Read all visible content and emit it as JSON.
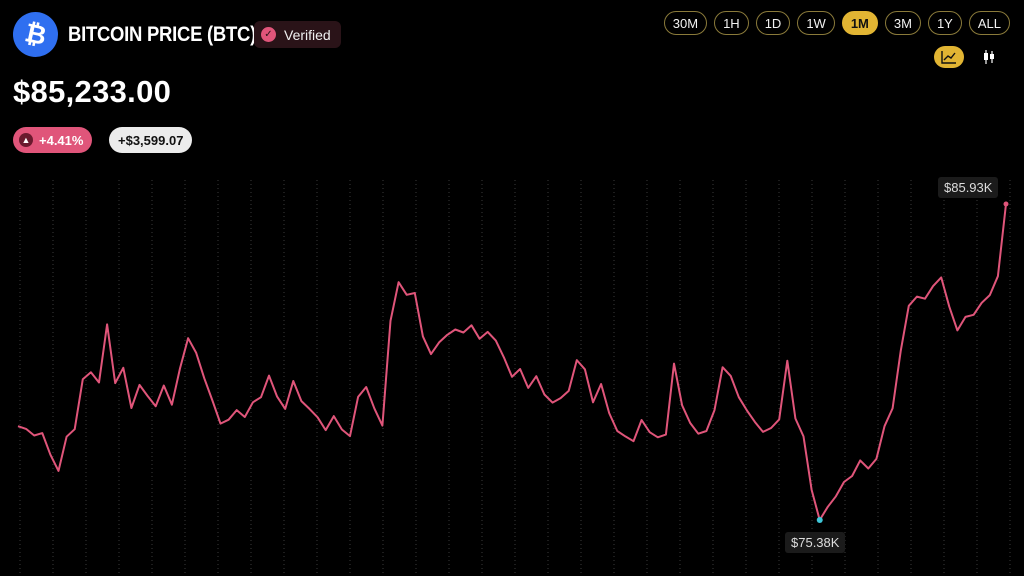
{
  "header": {
    "title": "BITCOIN PRICE (BTC)",
    "verified_label": "Verified",
    "logo_icon": "bitcoin-icon",
    "logo_color": "#2f6ff0"
  },
  "price": {
    "current": "$85,233.00",
    "change_pct": "+4.41%",
    "change_abs": "+$3,599.07",
    "change_color": "#e0557a"
  },
  "ranges": {
    "options": [
      "30M",
      "1H",
      "1D",
      "1W",
      "1M",
      "3M",
      "1Y",
      "ALL"
    ],
    "active": "1M",
    "accent": "#e2b533"
  },
  "view": {
    "options": [
      "line-chart-icon",
      "candlestick-icon"
    ],
    "active": "line-chart-icon"
  },
  "chart_data": {
    "type": "line",
    "title": "",
    "xlabel": "",
    "ylabel": "",
    "grid": "vertical-dotted",
    "line_color": "#e0557a",
    "max_label": "$85.93K",
    "min_label": "$75.38K",
    "ylim": [
      75380,
      85930
    ],
    "series": [
      {
        "values": [
          78510,
          78420,
          78200,
          78280,
          77560,
          77020,
          78160,
          78410,
          80080,
          80310,
          79970,
          81910,
          79950,
          80460,
          79120,
          79890,
          79520,
          79180,
          79870,
          79230,
          80440,
          81450,
          80960,
          80110,
          79370,
          78600,
          78730,
          79050,
          78820,
          79310,
          79480,
          80200,
          79500,
          79090,
          80020,
          79350,
          79090,
          78810,
          78380,
          78850,
          78400,
          78180,
          79490,
          79820,
          79110,
          78530,
          82030,
          83320,
          82900,
          82960,
          81510,
          80920,
          81310,
          81560,
          81740,
          81640,
          81880,
          81430,
          81660,
          81370,
          80810,
          80160,
          80420,
          79790,
          80180,
          79570,
          79300,
          79450,
          79690,
          80720,
          80410,
          79310,
          79920,
          78950,
          78350,
          78170,
          78010,
          78720,
          78310,
          78140,
          78230,
          80600,
          79210,
          78620,
          78260,
          78350,
          79050,
          80480,
          80190,
          79480,
          79040,
          78650,
          78320,
          78450,
          78740,
          80700,
          78770,
          78170,
          76390,
          75380,
          75820,
          76170,
          76650,
          76850,
          77370,
          77100,
          77420,
          78510,
          79110,
          81020,
          82530,
          82840,
          82770,
          83190,
          83480,
          82500,
          81710,
          82160,
          82230,
          82630,
          82890,
          83520,
          85930
        ]
      }
    ]
  }
}
